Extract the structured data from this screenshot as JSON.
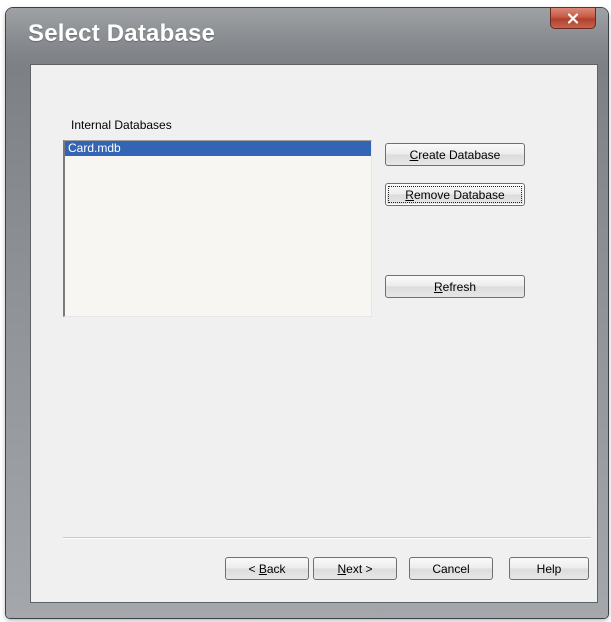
{
  "window": {
    "title": "Select Database",
    "close_glyph": "X"
  },
  "databases": {
    "group_label": "Internal Databases",
    "items": [
      {
        "label": "Card.mdb",
        "selected": true
      }
    ]
  },
  "actions": {
    "create": {
      "mnemonic": "C",
      "rest": "reate Database"
    },
    "remove": {
      "mnemonic": "R",
      "rest": "emove Database"
    },
    "refresh": {
      "mnemonic": "R",
      "rest": "efresh"
    }
  },
  "footer": {
    "back": {
      "prefix": "< ",
      "mnemonic": "B",
      "rest": "ack"
    },
    "next": {
      "mnemonic": "N",
      "rest": "ext >"
    },
    "cancel": "Cancel",
    "help": "Help"
  },
  "colors": {
    "selection": "#3464b4",
    "close_button": "#c75a45"
  }
}
